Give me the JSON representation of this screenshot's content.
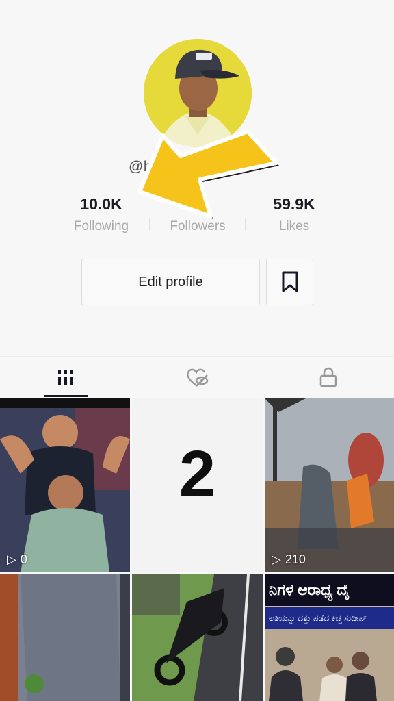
{
  "profile": {
    "username": "@b",
    "following_count": "10.0K",
    "following_label": "Following",
    "followers_count": "2",
    "followers_label": "Followers",
    "likes_count": "59.9K",
    "likes_label": "Likes"
  },
  "actions": {
    "edit_profile_label": "Edit profile"
  },
  "tabs": [
    {
      "icon": "grid-icon",
      "active": true
    },
    {
      "icon": "liked-hidden-icon",
      "active": false
    },
    {
      "icon": "lock-icon",
      "active": false
    }
  ],
  "videos": [
    {
      "views": "0"
    },
    {
      "overlay_number": "2"
    },
    {
      "views": "210"
    },
    {},
    {},
    {
      "banner_line1": "ನಿಗಳ ಆರಾಧ್ಯ ದೈ",
      "banner_line2": "ಲತಿಯನ್ನು ದತ್ತು ಪಡೆದ ಕಿಚ್ಚ ಸುದೀಪ್"
    }
  ],
  "colors": {
    "arrow_fill": "#f6c31b",
    "avatar_bg": "#e6d93a",
    "accent_text": "#161823"
  }
}
